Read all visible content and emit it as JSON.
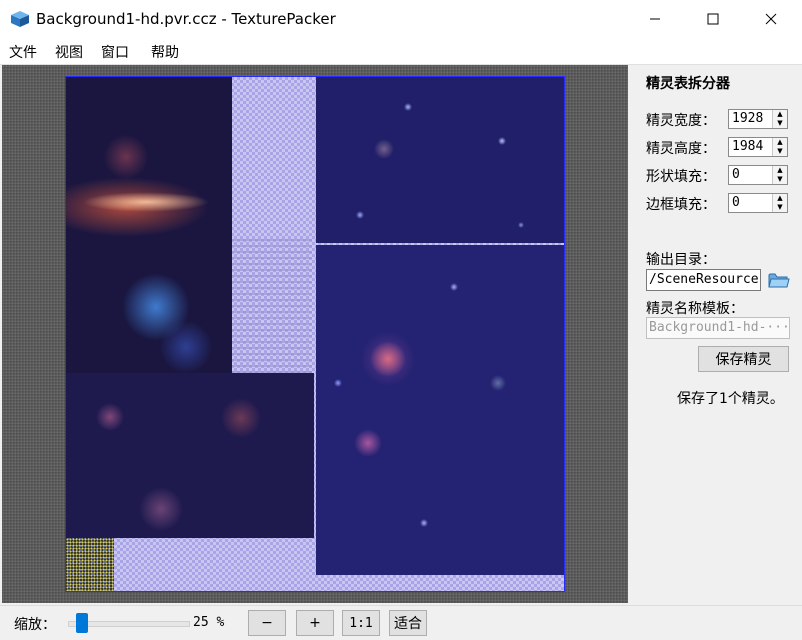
{
  "window": {
    "title": "Background1-hd.pvr.ccz - TexturePacker",
    "icon": "texturepacker-cube-icon",
    "controls": [
      "minimize-icon",
      "maximize-icon",
      "close-icon"
    ]
  },
  "menu": {
    "items": [
      {
        "label": "文件"
      },
      {
        "label": "视图"
      },
      {
        "label": "窗口"
      },
      {
        "label": "帮助"
      }
    ]
  },
  "panel": {
    "title": "精灵表拆分器",
    "fields": [
      {
        "label": "精灵宽度：",
        "value": "1928"
      },
      {
        "label": "精灵高度：",
        "value": "1984"
      },
      {
        "label": "形状填充：",
        "value": "0"
      },
      {
        "label": "边框填充：",
        "value": "0"
      }
    ],
    "output_dir_label": "输出目录：",
    "output_dir_value": "/SceneResource",
    "name_template_label": "精灵名称模板：",
    "name_template_value": "Background1-hd-···",
    "save_button": "保存精灵",
    "status": "保存了1个精灵。"
  },
  "bottom": {
    "zoom_label": "缩放：",
    "zoom_value": "25 %",
    "zoom_percent": 25,
    "minus": "−",
    "plus": "+",
    "one_to_one": "1:1",
    "fit": "适合"
  },
  "colors": {
    "accent": "#0078d7",
    "space_dark": "#1b1a5c",
    "space_blue": "#1f1d6e",
    "sheet_border": "#2a2aff"
  }
}
